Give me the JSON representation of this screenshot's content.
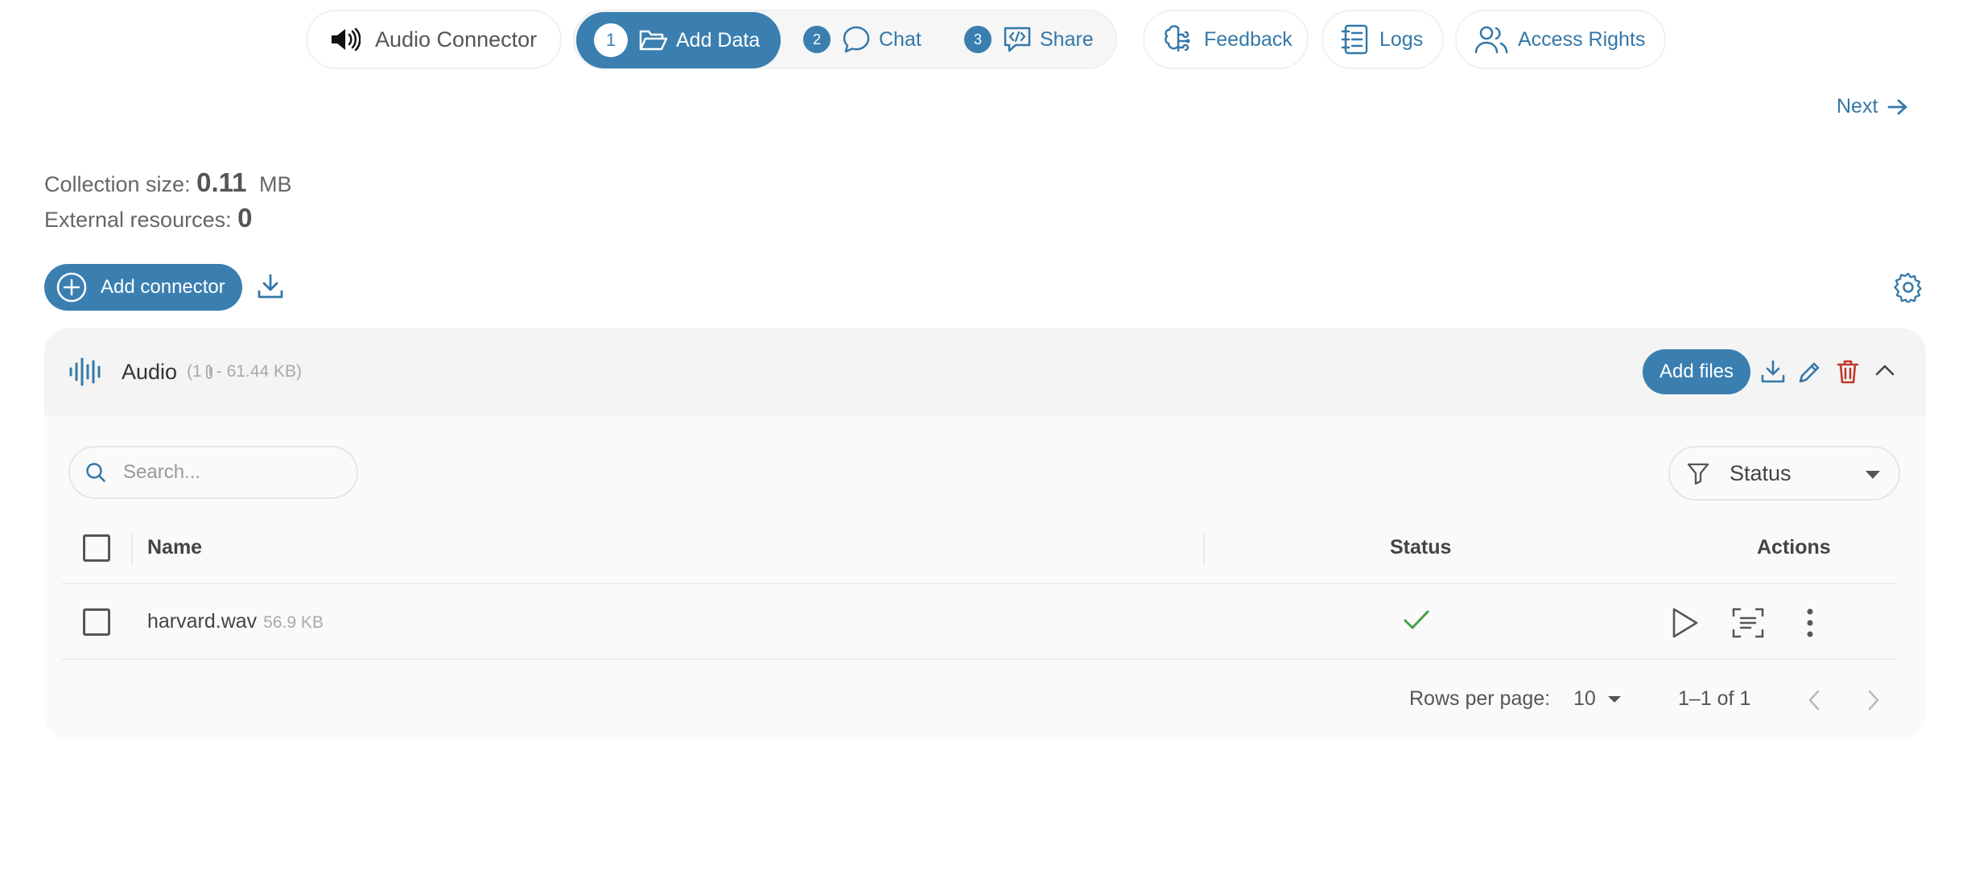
{
  "app": {
    "name": "Audio Connector",
    "icon": "speaker-icon"
  },
  "steps": [
    {
      "number": "1",
      "label": "Add Data",
      "icon": "folder-open-icon",
      "active": true
    },
    {
      "number": "2",
      "label": "Chat",
      "icon": "chat-bubble-icon",
      "active": false
    },
    {
      "number": "3",
      "label": "Share",
      "icon": "code-bubble-icon",
      "active": false
    }
  ],
  "nav": {
    "feedback": "Feedback",
    "logs": "Logs",
    "access_rights": "Access Rights"
  },
  "next_label": "Next",
  "stats": {
    "collection_label": "Collection size:",
    "collection_value": "0.11",
    "collection_unit": "MB",
    "external_label": "External resources:",
    "external_value": "0"
  },
  "add_connector_label": "Add connector",
  "connector": {
    "title": "Audio",
    "count": "(1",
    "size": "- 61.44 KB)",
    "add_files_label": "Add files"
  },
  "search": {
    "placeholder": "Search..."
  },
  "status_filter": {
    "label": "Status"
  },
  "table": {
    "columns": {
      "name": "Name",
      "status": "Status",
      "actions": "Actions"
    },
    "rows": [
      {
        "name": "harvard.wav",
        "size": "56.9 KB",
        "status": "done"
      }
    ]
  },
  "pagination": {
    "rows_per_page_label": "Rows per page:",
    "rows_per_page": "10",
    "range": "1–1 of 1"
  },
  "colors": {
    "accent": "#3a7fb0",
    "link": "#3478a8",
    "danger": "#c0392b",
    "success": "#43a047"
  }
}
